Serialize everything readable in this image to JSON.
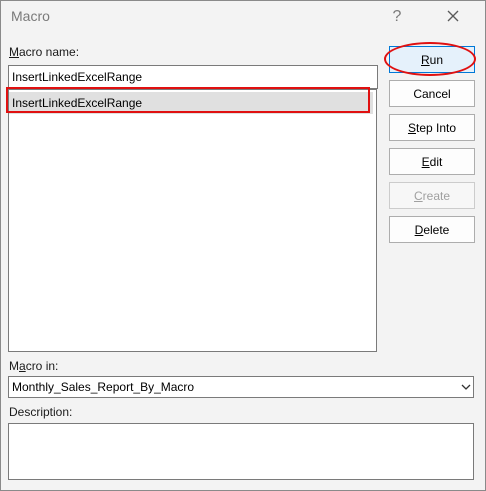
{
  "window": {
    "title": "Macro",
    "help_label": "?",
    "close_icon": "close-icon"
  },
  "macro_name": {
    "label_underlined": "M",
    "label_rest": "acro name:",
    "value": "InsertLinkedExcelRange"
  },
  "macro_list": {
    "items": [
      {
        "label": "InsertLinkedExcelRange",
        "selected": true
      }
    ]
  },
  "buttons": {
    "run": {
      "underlined": "R",
      "rest": "un"
    },
    "cancel": {
      "label": "Cancel"
    },
    "step_into": {
      "underlined": "S",
      "rest": "tep Into"
    },
    "edit": {
      "underlined": "E",
      "rest": "dit"
    },
    "create": {
      "underlined": "C",
      "rest": "reate"
    },
    "delete": {
      "underlined": "D",
      "rest": "elete"
    }
  },
  "macro_in": {
    "label_prefix": "M",
    "label_underlined": "a",
    "label_rest": "cro in:",
    "selected": "Monthly_Sales_Report_By_Macro"
  },
  "description": {
    "label": "Description:",
    "value": ""
  },
  "colors": {
    "annotation_red": "#e01010",
    "default_button_border": "#0078d7",
    "selection_gray": "#e0e0e0"
  }
}
